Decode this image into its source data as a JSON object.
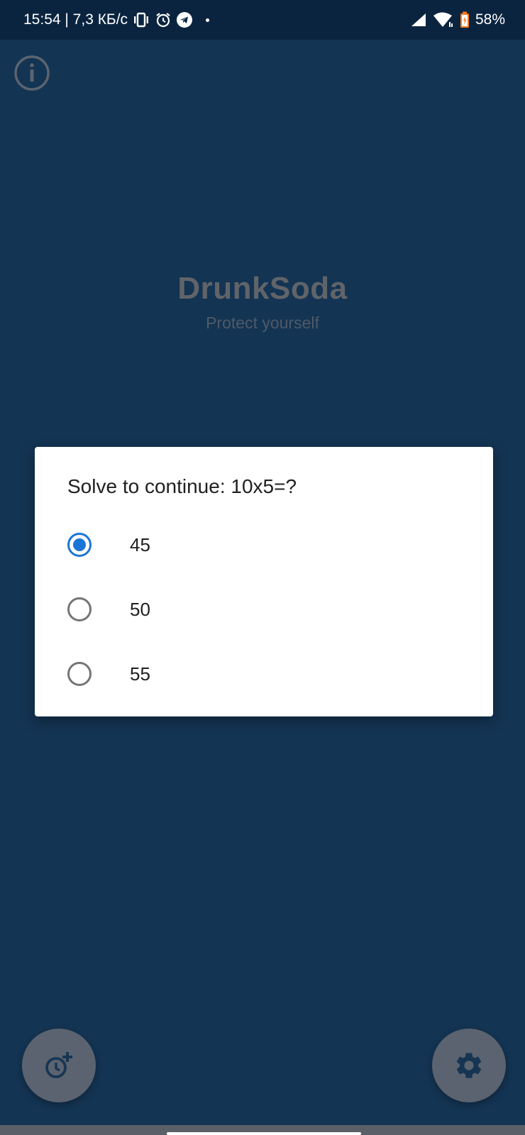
{
  "status_bar": {
    "time_and_speed": "15:54 | 7,3 КБ/с",
    "battery": "58%",
    "icons": [
      "vibrate-icon",
      "alarm-icon",
      "telegram-icon",
      "notification-dot",
      "signal-icon",
      "wifi-icon",
      "battery-icon"
    ]
  },
  "app": {
    "title": "DrunkSoda",
    "subtitle": "Protect yourself",
    "info_icon": "info-icon"
  },
  "dialog": {
    "title": "Solve to continue: 10x5=?",
    "options": [
      {
        "label": "45",
        "checked": true
      },
      {
        "label": "50",
        "checked": false
      },
      {
        "label": "55",
        "checked": false
      }
    ]
  },
  "fabs": {
    "left_icon": "add-alarm-icon",
    "right_icon": "gear-icon"
  },
  "colors": {
    "background": "#143453",
    "status_bar": "#0a2440",
    "radio_checked": "#1b75d8",
    "fab": "#5a636f"
  }
}
